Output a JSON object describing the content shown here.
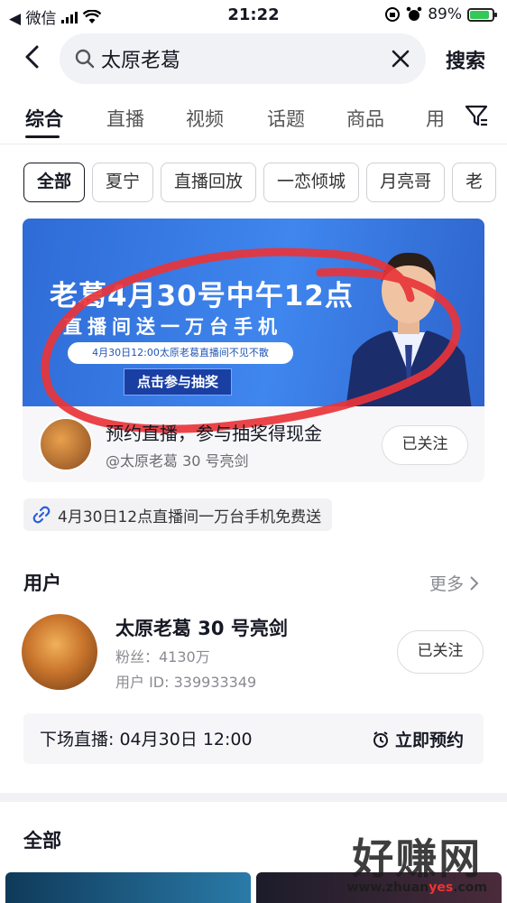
{
  "status_bar": {
    "carrier": "◀ 微信",
    "time": "21:22",
    "battery_percent": "89%",
    "battery_level": 0.89,
    "icons": [
      "signal-icon",
      "wifi-icon",
      "orientation-lock-icon",
      "alarm-icon",
      "battery-charging-icon"
    ]
  },
  "search": {
    "query": "太原老葛",
    "search_button": "搜索"
  },
  "tabs": [
    {
      "label": "综合",
      "active": true
    },
    {
      "label": "直播"
    },
    {
      "label": "视频"
    },
    {
      "label": "话题"
    },
    {
      "label": "商品"
    },
    {
      "label": "用"
    }
  ],
  "chips": [
    "全部",
    "夏宁",
    "直播回放",
    "一恋倾城",
    "月亮哥",
    "老"
  ],
  "live_card": {
    "banner_headline": "老葛4月30号中午12点",
    "banner_subline": "直播间送一万台手机",
    "banner_pill": "4月30日12:00太原老葛直播间不见不散",
    "banner_cta": "点击参与抽奖",
    "title": "预约直播，参与抽奖得现金",
    "account": "@太原老葛 30 号亮剑",
    "follow_label": "已关注",
    "annotation_color": "#e8343a"
  },
  "related_search": "4月30日12点直播间一万台手机免费送",
  "user_section": {
    "title": "用户",
    "more": "更多",
    "user": {
      "name": "太原老葛 30 号亮剑",
      "fans": "粉丝：4130万",
      "id": "用户 ID: 339933349",
      "follow_label": "已关注"
    },
    "next_live": "下场直播: 04月30日 12:00",
    "reserve": "立即预约"
  },
  "all_section": {
    "title": "全部"
  },
  "watermark": {
    "title": "好赚网",
    "url_prefix": "www.zhuan",
    "url_highlight": "yes",
    "url_suffix": ".com"
  },
  "colors": {
    "banner_blue": "#3a7ce6",
    "text_primary": "#161823",
    "annotation_red": "#e8343a"
  }
}
